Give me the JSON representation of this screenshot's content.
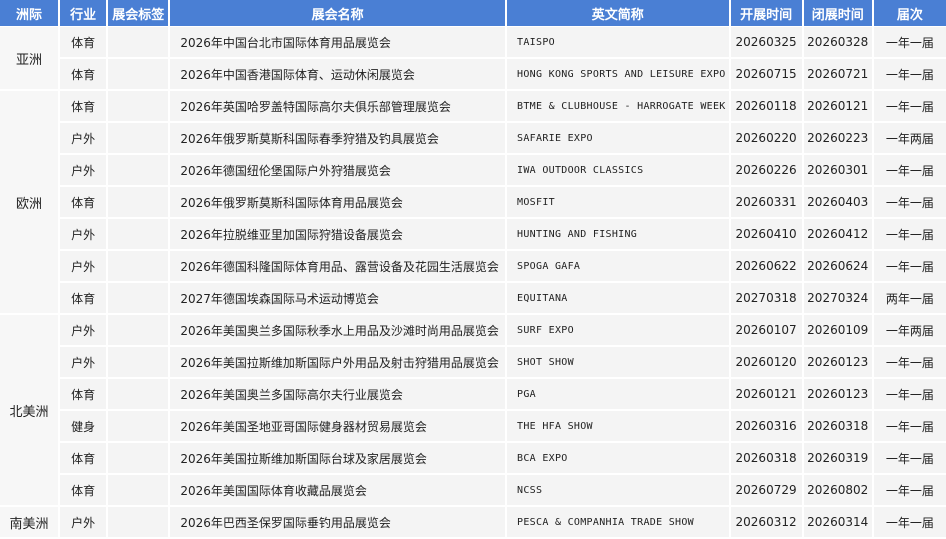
{
  "headers": [
    "洲际",
    "行业",
    "展会标签",
    "展会名称",
    "英文简称",
    "开展时间",
    "闭展时间",
    "届次"
  ],
  "groups": [
    {
      "continent": "亚洲",
      "rows": [
        [
          "体育",
          "",
          "2026年中国台北市国际体育用品展览会",
          "TAISPO",
          "20260325",
          "20260328",
          "一年一届"
        ],
        [
          "体育",
          "",
          "2026年中国香港国际体育、运动休闲展览会",
          "HONG KONG SPORTS AND LEISURE EXPO",
          "20260715",
          "20260721",
          "一年一届"
        ]
      ]
    },
    {
      "continent": "欧洲",
      "rows": [
        [
          "体育",
          "",
          "2026年英国哈罗盖特国际高尔夫俱乐部管理展览会",
          "BTME & CLUBHOUSE - HARROGATE WEEK",
          "20260118",
          "20260121",
          "一年一届"
        ],
        [
          "户外",
          "",
          "2026年俄罗斯莫斯科国际春季狩猎及钓具展览会",
          "SAFARIE EXPO",
          "20260220",
          "20260223",
          "一年两届"
        ],
        [
          "户外",
          "",
          "2026年德国纽伦堡国际户外狩猎展览会",
          "IWA OUTDOOR CLASSICS",
          "20260226",
          "20260301",
          "一年一届"
        ],
        [
          "体育",
          "",
          "2026年俄罗斯莫斯科国际体育用品展览会",
          "MOSFIT",
          "20260331",
          "20260403",
          "一年一届"
        ],
        [
          "户外",
          "",
          "2026年拉脱维亚里加国际狩猎设备展览会",
          "HUNTING AND FISHING",
          "20260410",
          "20260412",
          "一年一届"
        ],
        [
          "户外",
          "",
          "2026年德国科隆国际体育用品、露营设备及花园生活展览会",
          "SPOGA GAFA",
          "20260622",
          "20260624",
          "一年一届"
        ],
        [
          "体育",
          "",
          "2027年德国埃森国际马术运动博览会",
          "EQUITANA",
          "20270318",
          "20270324",
          "两年一届"
        ]
      ]
    },
    {
      "continent": "北美洲",
      "rows": [
        [
          "户外",
          "",
          "2026年美国奥兰多国际秋季水上用品及沙滩时尚用品展览会",
          "SURF EXPO",
          "20260107",
          "20260109",
          "一年两届"
        ],
        [
          "户外",
          "",
          "2026年美国拉斯维加斯国际户外用品及射击狩猎用品展览会",
          "SHOT SHOW",
          "20260120",
          "20260123",
          "一年一届"
        ],
        [
          "体育",
          "",
          "2026年美国奥兰多国际高尔夫行业展览会",
          "PGA",
          "20260121",
          "20260123",
          "一年一届"
        ],
        [
          "健身",
          "",
          "2026年美国圣地亚哥国际健身器材贸易展览会",
          "THE HFA SHOW",
          "20260316",
          "20260318",
          "一年一届"
        ],
        [
          "体育",
          "",
          "2026年美国拉斯维加斯国际台球及家居展览会",
          "BCA EXPO",
          "20260318",
          "20260319",
          "一年一届"
        ],
        [
          "体育",
          "",
          "2026年美国国际体育收藏品展览会",
          "NCSS",
          "20260729",
          "20260802",
          "一年一届"
        ]
      ]
    },
    {
      "continent": "南美洲",
      "rows": [
        [
          "户外",
          "",
          "2026年巴西圣保罗国际垂钓用品展览会",
          "PESCA & COMPANHIA TRADE SHOW",
          "20260312",
          "20260314",
          "一年一届"
        ]
      ]
    }
  ]
}
